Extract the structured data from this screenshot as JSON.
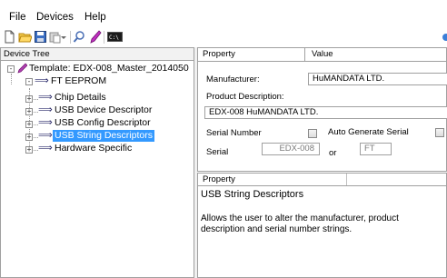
{
  "menu": {
    "file": "File",
    "devices": "Devices",
    "help": "Help"
  },
  "toolbar": {
    "icons": [
      "new-file-icon",
      "open-folder-icon",
      "save-icon",
      "paste-icon",
      "dropdown-icon",
      "search-icon",
      "program-icon",
      "console-icon"
    ],
    "console_label": "C:\\"
  },
  "tree": {
    "header": "Device Tree",
    "root": "Template: EDX-008_Master_2014050",
    "eeprom": "FT EEPROM",
    "children": [
      "Chip Details",
      "USB Device Descriptor",
      "USB Config Descriptor",
      "USB String Descriptors",
      "Hardware Specific"
    ],
    "selected_index": 3
  },
  "grid": {
    "col_property": "Property",
    "col_value": "Value"
  },
  "form": {
    "manufacturer_label": "Manufacturer:",
    "manufacturer_value": "HuMANDATA LTD.",
    "product_description_label": "Product Description:",
    "product_description_value": "EDX-008 HuMANDATA LTD.",
    "serial_number_label": "Serial Number",
    "auto_generate_label": "Auto Generate Serial",
    "serial_label": "Serial",
    "serial_prefix": "EDX-008",
    "or_label": "or",
    "serial_suffix": "FT"
  },
  "description": {
    "header": "Property",
    "title": "USB String Descriptors",
    "text": "Allows the user to alter the manufacturer, product description and serial number strings."
  },
  "colors": {
    "selection": "#3399ff",
    "border": "#a0a0a0"
  }
}
